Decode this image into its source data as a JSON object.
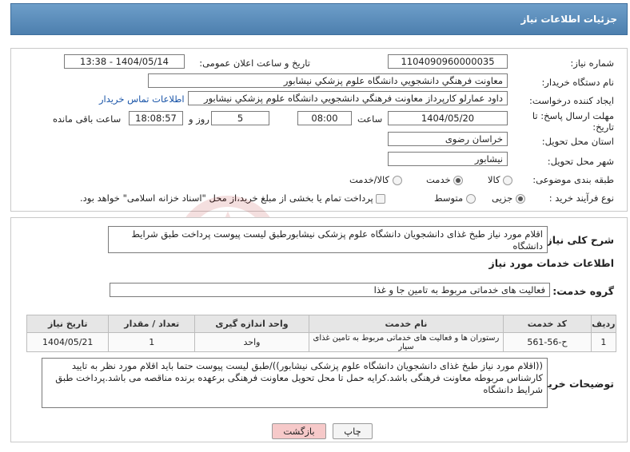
{
  "header": {
    "title": "جزئیات اطلاعات نیاز"
  },
  "form": {
    "need_number_label": "شماره نیاز:",
    "need_number": "1104090960000035",
    "announce_label": "تاریخ و ساعت اعلان عمومی:",
    "announce_value": "1404/05/14 - 13:38",
    "buyer_org_label": "نام دستگاه خریدار:",
    "buyer_org": "معاونت فرهنگي دانشجويي دانشگاه علوم پزشكي نيشابور",
    "creator_label": "ایجاد کننده درخواست:",
    "creator": "داود عمارلو كارپرداز معاونت فرهنگي دانشجويي دانشگاه علوم پزشكي نيشابور",
    "buyer_contact_link": "اطلاعات تماس خریدار",
    "deadline_label": "مهلت ارسال پاسخ: تا تاریخ:",
    "deadline_date": "1404/05/20",
    "time_label": "ساعت",
    "deadline_time": "08:00",
    "days_value": "5",
    "days_label": "روز و",
    "remaining_time": "18:08:57",
    "remaining_label": "ساعت باقی مانده",
    "province_label": "استان محل تحویل:",
    "province": "خراسان رضوی",
    "city_label": "شهر محل تحویل:",
    "city": "نيشابور",
    "category_label": "طبقه بندی موضوعی:",
    "category_options": [
      "کالا",
      "خدمت",
      "کالا/خدمت"
    ],
    "category_selected": "خدمت",
    "process_label": "نوع فرآیند خرید :",
    "process_options": [
      "جزیی",
      "متوسط"
    ],
    "process_selected": "جزیی",
    "payment_note": "پرداخت تمام یا بخشی از مبلغ خرید،از محل \"اسناد خزانه اسلامی\" خواهد بود."
  },
  "summary": {
    "label": "شرح کلی نیاز:",
    "text": "اقلام مورد نیاز طبخ غذای دانشجویان دانشگاه علوم پزشکی نیشابورطبق لیست پیوست پرداخت طبق شرایط دانشگاه"
  },
  "services": {
    "section_title": "اطلاعات خدمات مورد نیاز",
    "group_label": "گروه خدمت:",
    "group_value": "فعالیت های خدماتی مربوط به تامین جا و غذا",
    "columns": [
      "ردیف",
      "کد خدمت",
      "نام خدمت",
      "واحد اندازه گیری",
      "تعداد / مقدار",
      "تاریخ نیاز"
    ],
    "rows": [
      {
        "row": "1",
        "code": "ح-56-561",
        "name": "رستوران ها و فعالیت های خدماتی مربوط به تامین غذای سیار",
        "unit": "واحد",
        "qty": "1",
        "date": "1404/05/21"
      }
    ]
  },
  "buyer_notes": {
    "label": "توضیحات خریدار:",
    "text": "((اقلام مورد نیاز طبخ غذای دانشجویان دانشگاه علوم پزشکی نیشابور))/طبق لیست پیوست حتما باید اقلام مورد نظر به تایید کارشناس مربوطه معاونت فرهنگی باشد.کرایه حمل تا محل تحویل معاونت فرهنگی برعهده برنده مناقصه می باشد.پرداخت طبق شرایط دانشگاه"
  },
  "buttons": {
    "print": "چاپ",
    "back": "بازگشت"
  },
  "colors": {
    "header": "#5b8dbb",
    "back_button": "#f6c9c9",
    "link": "#1a55a8"
  }
}
